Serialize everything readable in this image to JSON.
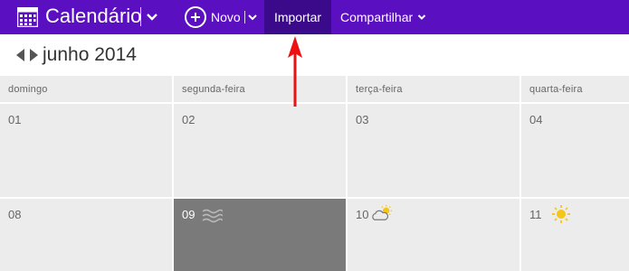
{
  "topbar": {
    "app_title": "Calendário",
    "new_label": "Novo",
    "import_label": "Importar",
    "share_label": "Compartilhar",
    "icons": [
      "calendar-icon",
      "chevron-down-icon",
      "plus-circle-icon",
      "chevron-down-icon",
      "chevron-down-icon"
    ],
    "background": "#5a0fc0",
    "active_button_background": "#3b0a8a"
  },
  "month_nav": {
    "title": "junho 2014"
  },
  "week_days": [
    "domingo",
    "segunda-feira",
    "terça-feira",
    "quarta-feira"
  ],
  "weeks": [
    {
      "days": [
        {
          "num": "01"
        },
        {
          "num": "02"
        },
        {
          "num": "03"
        },
        {
          "num": "04"
        }
      ]
    },
    {
      "days": [
        {
          "num": "08"
        },
        {
          "num": "09",
          "weather": "fog-icon",
          "selected": true
        },
        {
          "num": "10",
          "weather": "partly-cloudy-icon"
        },
        {
          "num": "11",
          "weather": "sun-icon"
        }
      ]
    }
  ],
  "annotation": {
    "type": "red-arrow",
    "color": "#ee1111",
    "points_to": "import-button"
  }
}
